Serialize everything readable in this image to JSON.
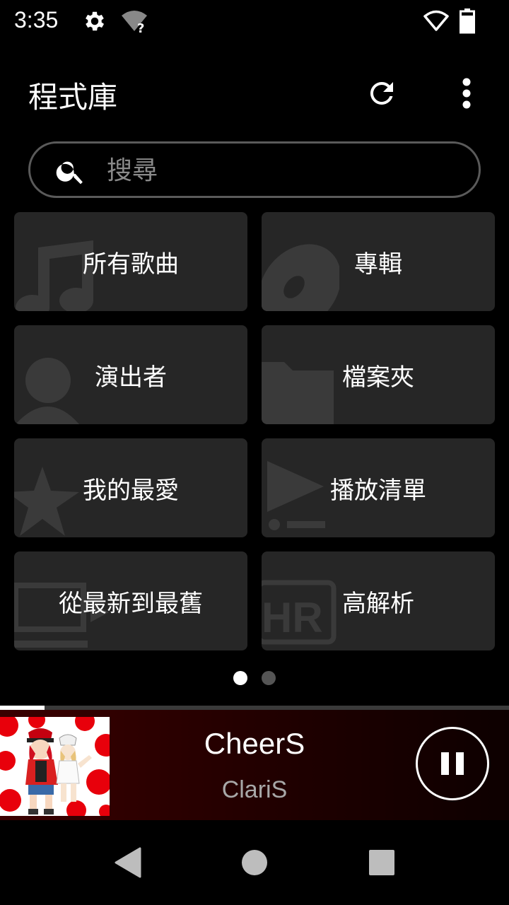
{
  "status_bar": {
    "time": "3:35",
    "icons": [
      "settings-gear-icon",
      "wifi-unknown-icon",
      "wifi-icon",
      "battery-icon"
    ]
  },
  "app_bar": {
    "title": "程式庫",
    "actions": [
      "refresh-icon",
      "overflow-menu-icon"
    ]
  },
  "search": {
    "placeholder": "搜尋",
    "value": ""
  },
  "library": {
    "tiles": [
      {
        "label": "所有歌曲",
        "icon": "music-note-icon"
      },
      {
        "label": "專輯",
        "icon": "disc-icon"
      },
      {
        "label": "演出者",
        "icon": "person-icon"
      },
      {
        "label": "檔案夾",
        "icon": "folder-icon"
      },
      {
        "label": "我的最愛",
        "icon": "star-icon"
      },
      {
        "label": "播放清單",
        "icon": "playlist-icon"
      },
      {
        "label": "從最新到最舊",
        "icon": "recent-icon"
      },
      {
        "label": "高解析",
        "icon": "hr-icon"
      }
    ],
    "pages": 2,
    "current_page": 1
  },
  "now_playing": {
    "title": "CheerS",
    "artist": "ClariS",
    "progress": 0.087,
    "state": "playing",
    "colors": {
      "bar_start": "#3a0000",
      "bar_end": "#0d0000"
    }
  },
  "nav": [
    "back-icon",
    "home-icon",
    "recents-icon"
  ]
}
